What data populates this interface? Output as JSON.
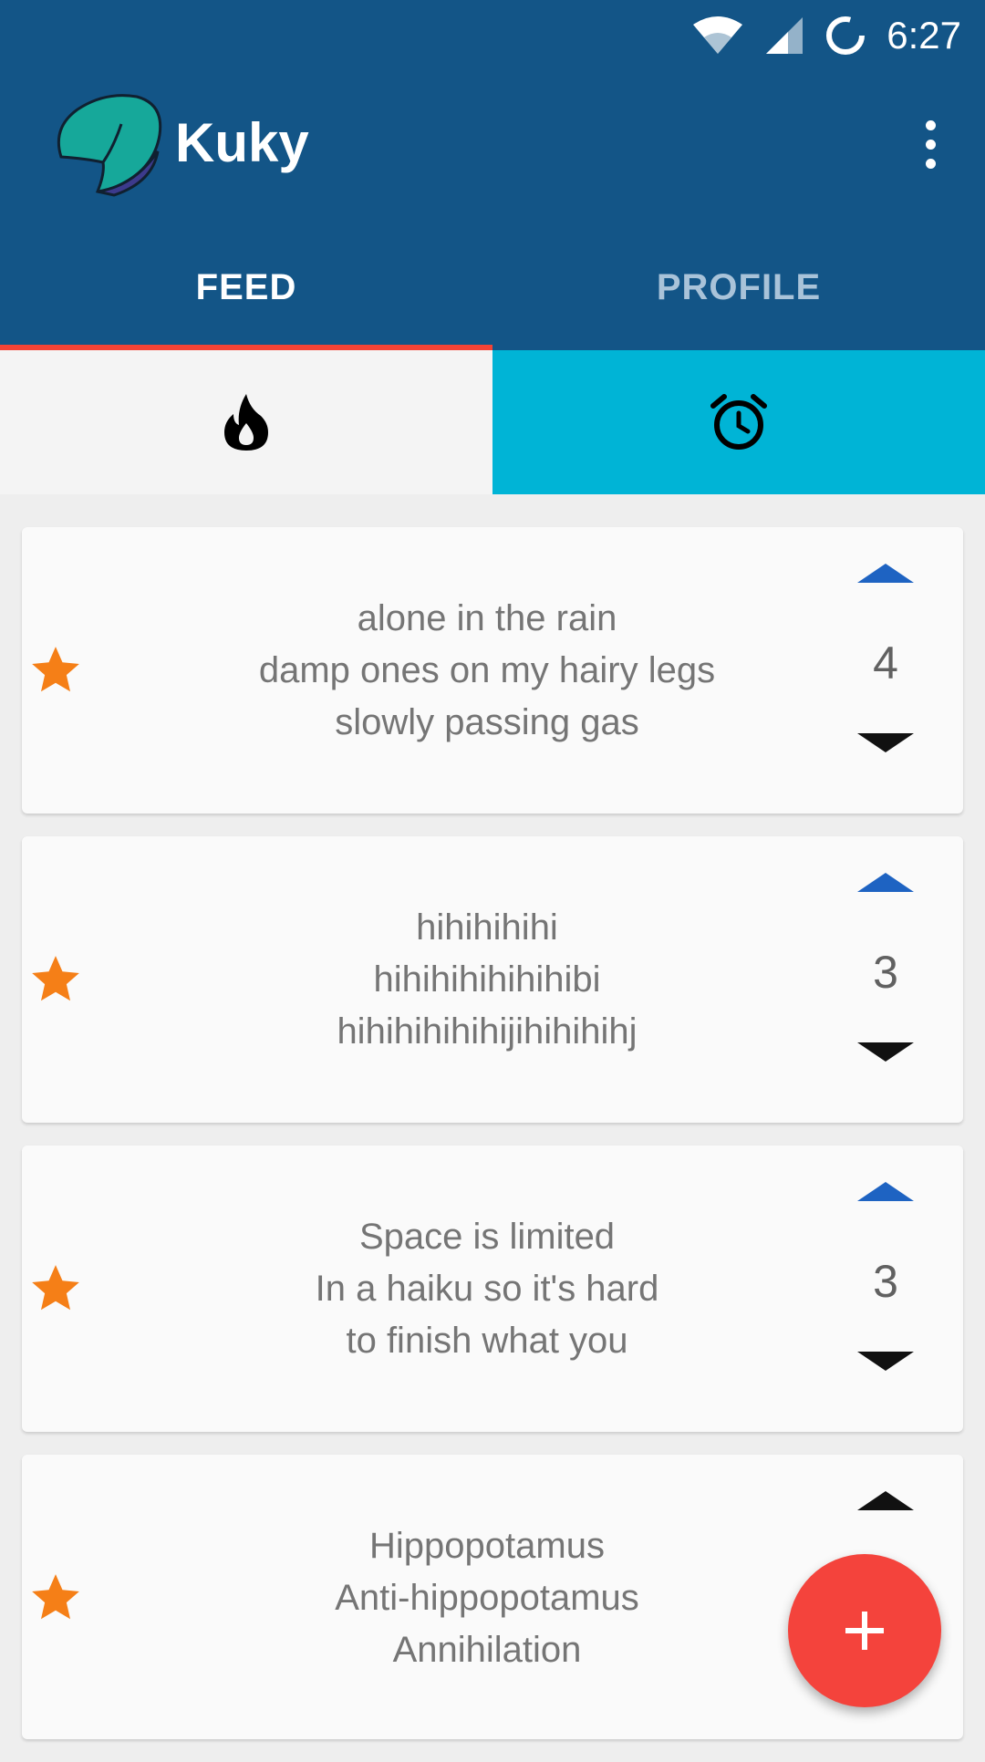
{
  "status_bar": {
    "time": "6:27",
    "icons": [
      "wifi-icon",
      "signal-icon",
      "sync-icon"
    ]
  },
  "app": {
    "title": "Kuky",
    "logo": "fortune-cookie-logo",
    "menu_icon": "more-vert-icon"
  },
  "tabs": [
    {
      "label": "FEED",
      "active": true
    },
    {
      "label": "PROFILE",
      "active": false
    }
  ],
  "subtabs": [
    {
      "icon": "fire-icon",
      "active": false
    },
    {
      "icon": "alarm-clock-icon",
      "active": true
    }
  ],
  "posts": [
    {
      "lines": [
        "alone in the rain",
        "damp ones on my hairy legs",
        "slowly passing gas"
      ],
      "score": "4"
    },
    {
      "lines": [
        "hihihihihi",
        "hihihihihihihibi",
        "hihihihihihijihihihihj"
      ],
      "score": "3"
    },
    {
      "lines": [
        "Space is limited",
        "In a haiku so it's hard",
        "to finish what you"
      ],
      "score": "3"
    },
    {
      "lines": [
        "Hippopotamus",
        "Anti-hippopotamus",
        "Annihilation"
      ],
      "score": ""
    }
  ],
  "fab": {
    "icon": "add-icon",
    "label": "+"
  },
  "colors": {
    "primary": "#135587",
    "accent": "#f44336",
    "subtab_active": "#00b4d6",
    "star": "#f57f17",
    "upvote": "#1e63c2"
  }
}
